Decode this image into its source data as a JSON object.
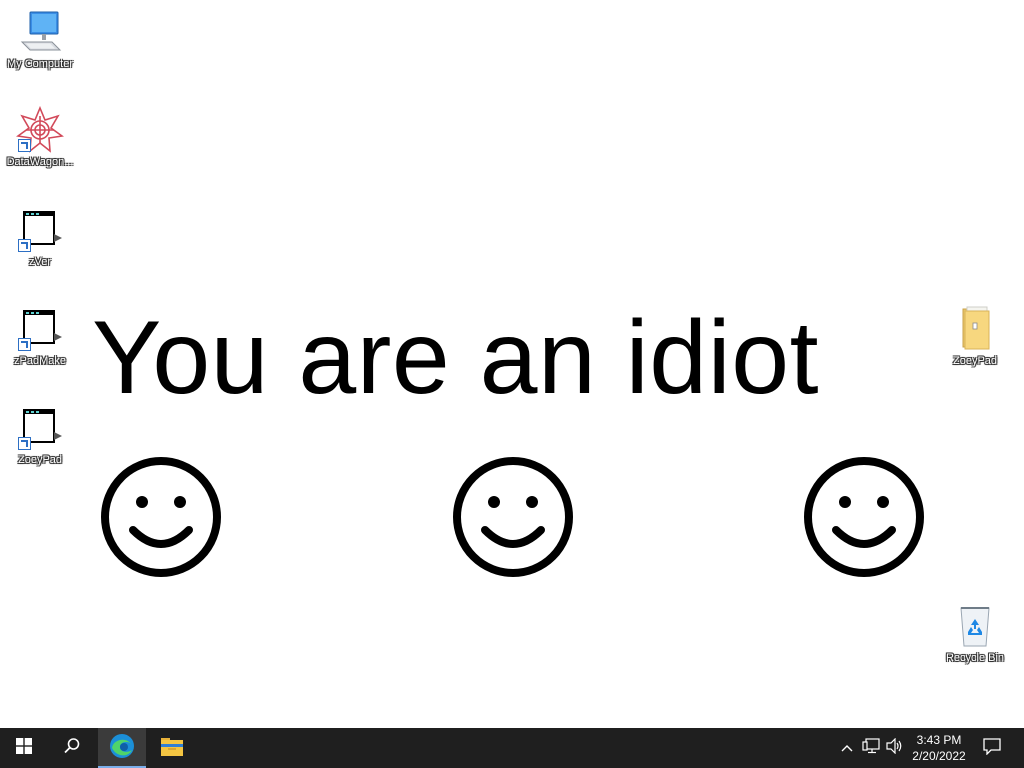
{
  "desktop": {
    "icons_left": [
      {
        "label": "My Computer",
        "icon": "computer-icon"
      },
      {
        "label": "DataWagon...",
        "icon": "datawagon-icon"
      },
      {
        "label": "zVer",
        "icon": "window-app-icon"
      },
      {
        "label": "zPadMake",
        "icon": "window-app-icon"
      },
      {
        "label": "ZoeyPad",
        "icon": "window-app-icon"
      }
    ],
    "icons_right": [
      {
        "label": "ZoeyPad",
        "icon": "folder-icon"
      },
      {
        "label": "Recycle Bin",
        "icon": "recycle-bin-icon"
      }
    ]
  },
  "popup": {
    "message": "You are an idiot",
    "smileys": [
      "smiley-icon",
      "smiley-icon",
      "smiley-icon"
    ]
  },
  "taskbar": {
    "buttons": [
      {
        "icon": "windows-start-icon"
      },
      {
        "icon": "search-icon"
      },
      {
        "icon": "edge-browser-icon",
        "active": true
      },
      {
        "icon": "file-explorer-icon"
      }
    ],
    "tray": {
      "icons": [
        "chevron-up-icon",
        "network-icon",
        "volume-icon"
      ],
      "time": "3:43 PM",
      "date": "2/20/2022",
      "notification_icon": "notification-icon"
    },
    "accent": "#7aaeea",
    "background": "#1f1f1f"
  }
}
